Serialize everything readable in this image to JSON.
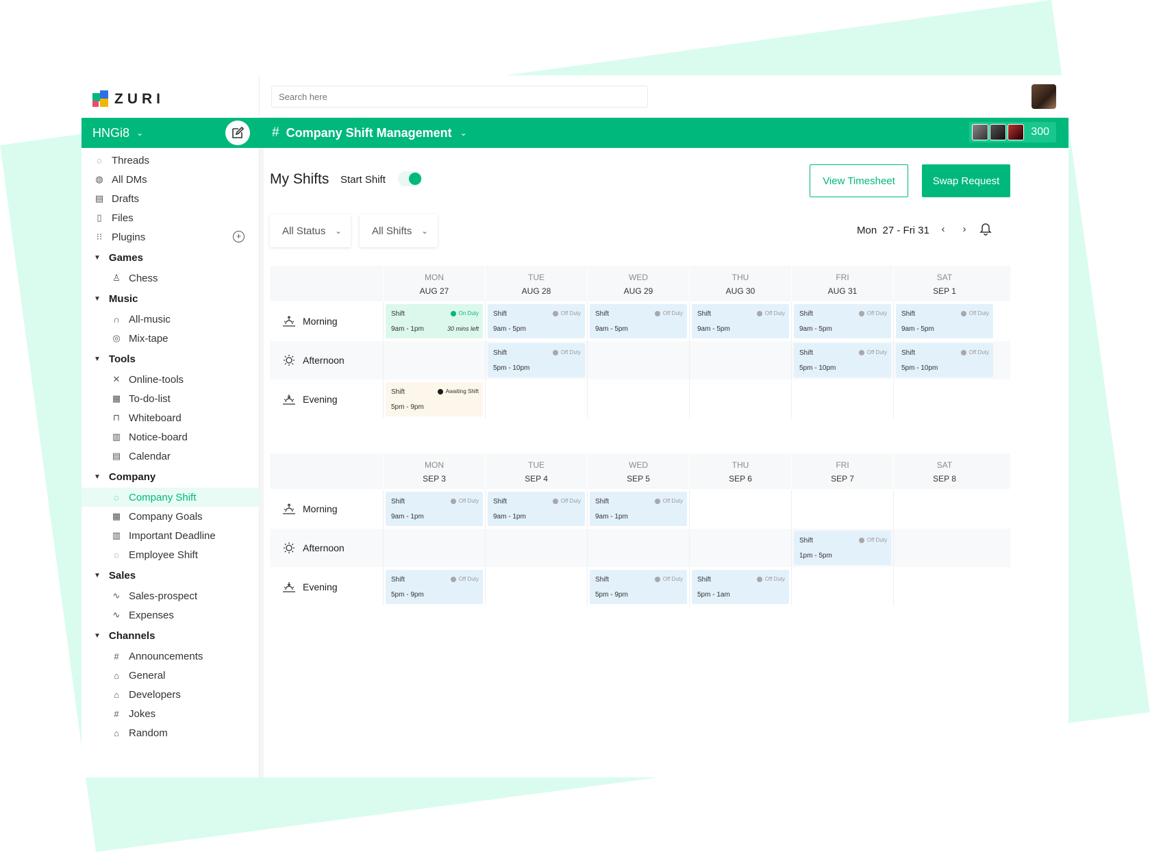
{
  "app": {
    "logo_text": "ZURI",
    "search_placeholder": "Search here"
  },
  "workspace": {
    "name": "HNGi8"
  },
  "colors": {
    "brand": "#00b87c",
    "offduty_card": "#e3f1fb",
    "onduty_card": "#dcf8ec",
    "awaiting_card": "#fdf6ea",
    "background_shape": "#dafcef"
  },
  "nav": {
    "top": [
      {
        "label": "Threads",
        "icon": "threads-icon"
      },
      {
        "label": "All DMs",
        "icon": "dms-icon"
      },
      {
        "label": "Drafts",
        "icon": "drafts-icon"
      },
      {
        "label": "Files",
        "icon": "files-icon"
      },
      {
        "label": "Plugins",
        "icon": "plugins-icon"
      }
    ],
    "sections": [
      {
        "title": "Games",
        "items": [
          {
            "label": "Chess",
            "icon": "chess-icon"
          }
        ]
      },
      {
        "title": "Music",
        "items": [
          {
            "label": "All-music",
            "icon": "headphones-icon"
          },
          {
            "label": "Mix-tape",
            "icon": "disc-icon"
          }
        ]
      },
      {
        "title": "Tools",
        "items": [
          {
            "label": "Online-tools",
            "icon": "tools-icon"
          },
          {
            "label": "To-do-list",
            "icon": "todo-icon"
          },
          {
            "label": "Whiteboard",
            "icon": "whiteboard-icon"
          },
          {
            "label": "Notice-board",
            "icon": "notice-icon"
          },
          {
            "label": "Calendar",
            "icon": "calendar-icon"
          }
        ]
      },
      {
        "title": "Company",
        "items": [
          {
            "label": "Company Shift",
            "icon": "shift-icon",
            "active": true
          },
          {
            "label": "Company Goals",
            "icon": "goals-icon"
          },
          {
            "label": "Important Deadline",
            "icon": "deadline-icon"
          },
          {
            "label": "Employee Shift",
            "icon": "shift-icon"
          }
        ]
      },
      {
        "title": "Sales",
        "items": [
          {
            "label": "Sales-prospect",
            "icon": "chart-icon"
          },
          {
            "label": "Expenses",
            "icon": "chart-icon"
          }
        ]
      },
      {
        "title": "Channels",
        "items": [
          {
            "label": "Announcements",
            "icon": "hash-icon"
          },
          {
            "label": "General",
            "icon": "lock-icon"
          },
          {
            "label": "Developers",
            "icon": "lock-icon"
          },
          {
            "label": "Jokes",
            "icon": "hash-icon"
          },
          {
            "label": "Random",
            "icon": "lock-icon"
          }
        ]
      }
    ]
  },
  "channel": {
    "name": "Company Shift Management",
    "member_count": "300"
  },
  "page": {
    "title": "My Shifts",
    "start_shift_label": "Start Shift",
    "view_timesheet_label": "View Timesheet",
    "swap_request_label": "Swap Request",
    "filter_status": "All Status",
    "filter_shifts": "All Shifts",
    "date_range": "Mon  27 - Fri 31"
  },
  "rows": [
    "Morning",
    "Afternoon",
    "Evening"
  ],
  "weeks": [
    {
      "days": [
        {
          "name": "MON",
          "date": "AUG 27"
        },
        {
          "name": "TUE",
          "date": "AUG 28"
        },
        {
          "name": "WED",
          "date": "AUG 29"
        },
        {
          "name": "THU",
          "date": "AUG 30"
        },
        {
          "name": "FRI",
          "date": "AUG 31"
        },
        {
          "name": "SAT",
          "date": "SEP 1"
        }
      ],
      "cells": [
        [
          {
            "label": "Shift",
            "time": "9am - 1pm",
            "status": "On Duty",
            "kind": "on",
            "note": "30 mins left"
          },
          {
            "label": "Shift",
            "time": "9am - 5pm",
            "status": "Off Duty",
            "kind": "off"
          },
          {
            "label": "Shift",
            "time": "9am - 5pm",
            "status": "Off Duty",
            "kind": "off"
          },
          {
            "label": "Shift",
            "time": "9am - 5pm",
            "status": "Off Duty",
            "kind": "off"
          },
          {
            "label": "Shift",
            "time": "9am - 5pm",
            "status": "Off Duty",
            "kind": "off"
          },
          {
            "label": "Shift",
            "time": "9am - 5pm",
            "status": "Off Duty",
            "kind": "off"
          }
        ],
        [
          null,
          {
            "label": "Shift",
            "time": "5pm - 10pm",
            "status": "Off Duty",
            "kind": "off"
          },
          null,
          null,
          {
            "label": "Shift",
            "time": "5pm - 10pm",
            "status": "Off Duty",
            "kind": "off"
          },
          {
            "label": "Shift",
            "time": "5pm - 10pm",
            "status": "Off Duty",
            "kind": "off"
          }
        ],
        [
          {
            "label": "Shift",
            "time": "5pm - 9pm",
            "status": "Awaiting Shift",
            "kind": "await"
          },
          null,
          null,
          null,
          null,
          null
        ]
      ]
    },
    {
      "days": [
        {
          "name": "MON",
          "date": "SEP 3"
        },
        {
          "name": "TUE",
          "date": "SEP 4"
        },
        {
          "name": "WED",
          "date": "SEP 5"
        },
        {
          "name": "THU",
          "date": "SEP 6"
        },
        {
          "name": "FRI",
          "date": "SEP 7"
        },
        {
          "name": "SAT",
          "date": "SEP 8"
        }
      ],
      "cells": [
        [
          {
            "label": "Shift",
            "time": "9am - 1pm",
            "status": "Off Duty",
            "kind": "off"
          },
          {
            "label": "Shift",
            "time": "9am - 1pm",
            "status": "Off Duty",
            "kind": "off"
          },
          {
            "label": "Shift",
            "time": "9am - 1pm",
            "status": "Off Duty",
            "kind": "off"
          },
          null,
          null,
          null
        ],
        [
          null,
          null,
          null,
          null,
          {
            "label": "Shift",
            "time": "1pm - 5pm",
            "status": "Off Duty",
            "kind": "off"
          },
          null
        ],
        [
          {
            "label": "Shift",
            "time": "5pm - 9pm",
            "status": "Off Duty",
            "kind": "off"
          },
          null,
          {
            "label": "Shift",
            "time": "5pm - 9pm",
            "status": "Off Duty",
            "kind": "off"
          },
          {
            "label": "Shift",
            "time": "5pm - 1am",
            "status": "Off Duty",
            "kind": "off"
          },
          null,
          null
        ]
      ]
    }
  ]
}
